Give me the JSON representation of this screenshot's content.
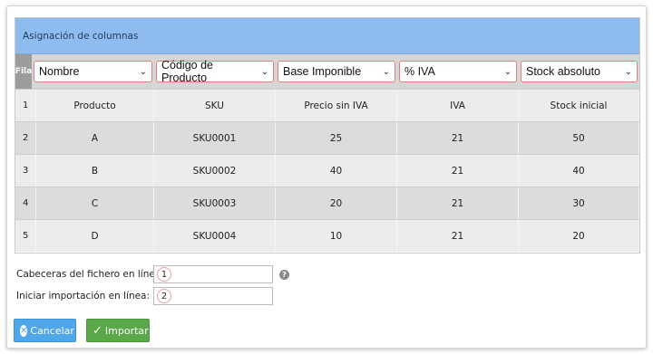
{
  "panel": {
    "title": "Asignación de columnas"
  },
  "mapping": {
    "fila_label": "Fila",
    "selects": [
      "Nombre",
      "Código de Producto",
      "Base Imponible",
      "% IVA",
      "Stock absoluto"
    ]
  },
  "rows": [
    {
      "n": "1",
      "cells": [
        "Producto",
        "SKU",
        "Precio sin IVA",
        "IVA",
        "Stock inicial"
      ]
    },
    {
      "n": "2",
      "cells": [
        "A",
        "SKU0001",
        "25",
        "21",
        "50"
      ]
    },
    {
      "n": "3",
      "cells": [
        "B",
        "SKU0002",
        "40",
        "21",
        "40"
      ]
    },
    {
      "n": "4",
      "cells": [
        "C",
        "SKU0003",
        "20",
        "21",
        "30"
      ]
    },
    {
      "n": "5",
      "cells": [
        "D",
        "SKU0004",
        "10",
        "21",
        "20"
      ]
    }
  ],
  "form": {
    "header_line_label": "Cabeceras del fichero en línea:",
    "header_line_value": "1",
    "start_line_label": "Iniciar importación en línea:",
    "start_line_value": "2"
  },
  "buttons": {
    "cancel": "Cancelar",
    "import": "Importar"
  }
}
